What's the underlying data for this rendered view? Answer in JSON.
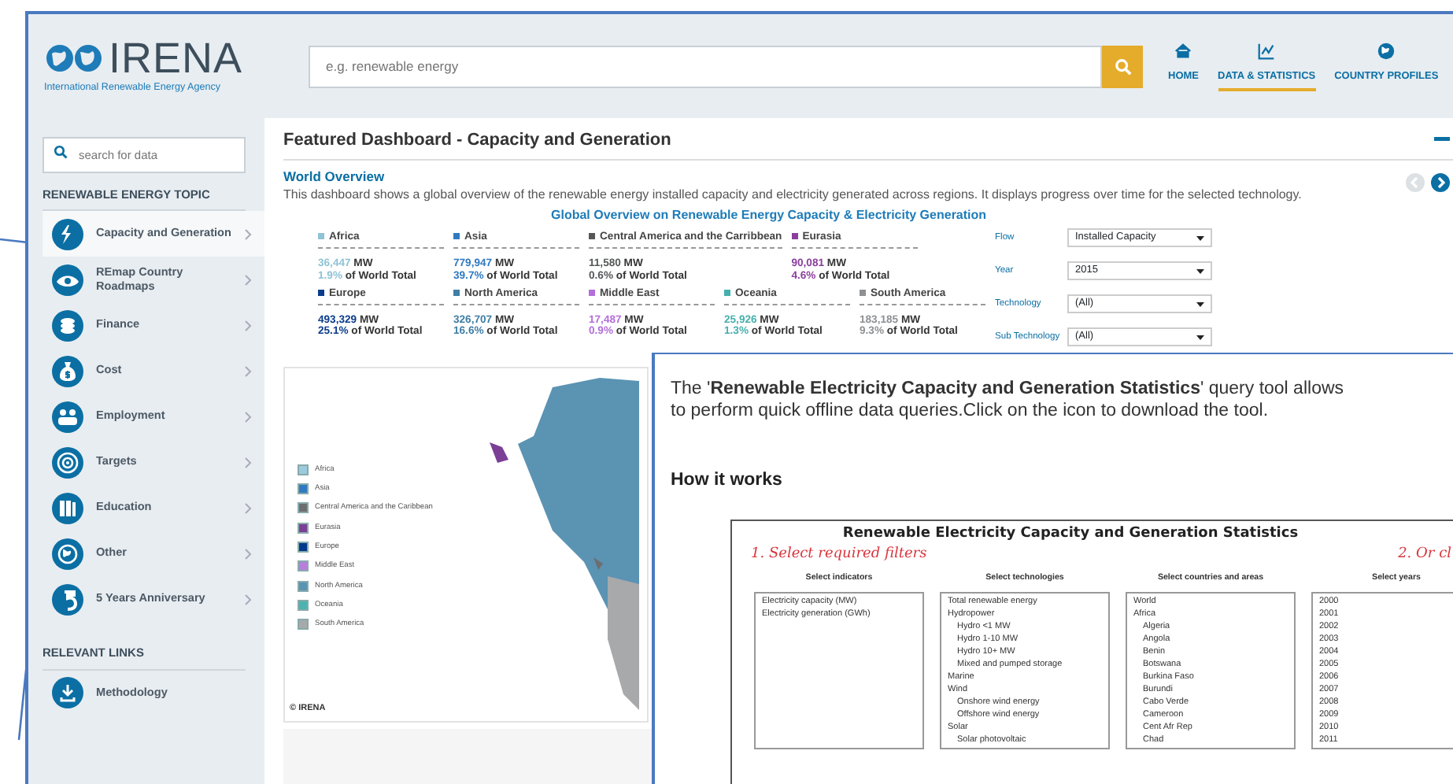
{
  "header": {
    "logo": {
      "name": "IRENA",
      "tagline": "International Renewable Energy Agency"
    },
    "search": {
      "placeholder": "e.g. renewable energy"
    },
    "nav": [
      {
        "label": "HOME",
        "kind": "home",
        "selected": false
      },
      {
        "label": "DATA & STATISTICS",
        "kind": "chart",
        "selected": true
      },
      {
        "label": "COUNTRY PROFILES",
        "kind": "globe",
        "selected": false
      }
    ]
  },
  "sidebar": {
    "search": {
      "placeholder": "search for data"
    },
    "topics_title": "RENEWABLE ENERGY TOPIC",
    "topics": [
      {
        "label": "Capacity and Generation",
        "kind": "lightning",
        "selected": true
      },
      {
        "label": "REmap Country Roadmaps",
        "kind": "eye",
        "selected": false
      },
      {
        "label": "Finance",
        "kind": "coins",
        "selected": false
      },
      {
        "label": "Cost",
        "kind": "moneybag",
        "selected": false
      },
      {
        "label": "Employment",
        "kind": "people",
        "selected": false
      },
      {
        "label": "Targets",
        "kind": "target",
        "selected": false
      },
      {
        "label": "Education",
        "kind": "books",
        "selected": false
      },
      {
        "label": "Other",
        "kind": "globe",
        "selected": false
      },
      {
        "label": "5 Years Anniversary",
        "kind": "five",
        "selected": false
      }
    ],
    "links_title": "RELEVANT LINKS",
    "links": [
      {
        "label": "Methodology"
      }
    ]
  },
  "dashboard": {
    "title": "Featured Dashboard - Capacity and Generation",
    "subtitle": "World Overview",
    "description": "This dashboard shows a global overview of the renewable energy installed capacity and electricity generated across regions. It displays progress over time for the selected technology.",
    "chart_title": "Global Overview on Renewable Energy Capacity & Electricity Generation",
    "region_rows": [
      [
        {
          "name": "Africa",
          "color": "#8fc3d6",
          "value": "36,447",
          "unit": "MW",
          "share": "1.9%",
          "share_label": "of World Total"
        },
        {
          "name": "Asia",
          "color": "#2f7ac0",
          "value": "779,947",
          "unit": "MW",
          "share": "39.7%",
          "share_label": "of World Total"
        },
        {
          "name": "Central America and the Carribbean",
          "color": "#555759",
          "value": "11,580",
          "unit": "MW",
          "share": "0.6%",
          "share_label": "of World Total"
        },
        {
          "name": "Eurasia",
          "color": "#8a3f9c",
          "value": "90,081",
          "unit": "MW",
          "share": "4.6%",
          "share_label": "of World Total"
        }
      ],
      [
        {
          "name": "Europe",
          "color": "#0b3c8c",
          "value": "493,329",
          "unit": "MW",
          "share": "25.1%",
          "share_label": "of World Total"
        },
        {
          "name": "North America",
          "color": "#3f7ea6",
          "value": "326,707",
          "unit": "MW",
          "share": "16.6%",
          "share_label": "of World Total"
        },
        {
          "name": "Middle East",
          "color": "#b46fd9",
          "value": "17,487",
          "unit": "MW",
          "share": "0.9%",
          "share_label": "of World Total"
        },
        {
          "name": "Oceania",
          "color": "#45b0ad",
          "value": "25,926",
          "unit": "MW",
          "share": "1.3%",
          "share_label": "of World Total"
        },
        {
          "name": "South America",
          "color": "#8e9194",
          "value": "183,185",
          "unit": "MW",
          "share": "9.3%",
          "share_label": "of World Total"
        }
      ]
    ],
    "filters": [
      {
        "label": "Flow",
        "value": "Installed Capacity"
      },
      {
        "label": "Year",
        "value": "2015"
      },
      {
        "label": "Technology",
        "value": "(All)"
      },
      {
        "label": "Sub Technology",
        "value": "(All)"
      }
    ],
    "legend": [
      {
        "name": "Africa",
        "color": "#9ccbdf"
      },
      {
        "name": "Asia",
        "color": "#2f7ac0"
      },
      {
        "name": "Central America and the Caribbean",
        "color": "#6d6e70"
      },
      {
        "name": "Eurasia",
        "color": "#7b3f96"
      },
      {
        "name": "Europe",
        "color": "#003a8c"
      },
      {
        "name": "Middle East",
        "color": "#b77fdc"
      },
      {
        "name": "North America",
        "color": "#5b93b3"
      },
      {
        "name": "Oceania",
        "color": "#4db3b0"
      },
      {
        "name": "South America",
        "color": "#a7a9ab"
      }
    ],
    "copyright": "© IRENA"
  },
  "overlay": {
    "intro": [
      "The '**Renewable Electricity Capacity and Generation Statistics**' query tool allows",
      "to perform quick offline data queries.Click on the icon to download the tool."
    ],
    "heading": "How it works",
    "tool": {
      "title": "Renewable Electricity Capacity and Generation Statistics",
      "step_1": "1. Select required filters",
      "step_2": "2. Or cl",
      "columns": [
        {
          "heading": "Select indicators",
          "items": [
            {
              "label": "Electricity capacity (MW)"
            },
            {
              "label": "Electricity generation (GWh)"
            }
          ]
        },
        {
          "heading": "Select technologies",
          "items": [
            {
              "label": "Total renewable energy"
            },
            {
              "label": "Hydropower",
              "children": [
                {
                  "label": "Hydro <1 MW"
                },
                {
                  "label": "Hydro 1-10 MW"
                },
                {
                  "label": "Hydro 10+ MW"
                },
                {
                  "label": "Mixed and pumped storage"
                }
              ]
            },
            {
              "label": "Marine"
            },
            {
              "label": "Wind",
              "children": [
                {
                  "label": "Onshore wind energy"
                },
                {
                  "label": "Offshore wind energy"
                }
              ]
            },
            {
              "label": "Solar",
              "children": [
                {
                  "label": "Solar photovoltaic"
                }
              ]
            }
          ]
        },
        {
          "heading": "Select countries and areas",
          "items": [
            {
              "label": "World"
            },
            {
              "label": "Africa",
              "children": [
                {
                  "label": "Algeria"
                },
                {
                  "label": "Angola"
                },
                {
                  "label": "Benin"
                },
                {
                  "label": "Botswana"
                },
                {
                  "label": "Burkina Faso"
                },
                {
                  "label": "Burundi"
                },
                {
                  "label": "Cabo Verde"
                },
                {
                  "label": "Cameroon"
                },
                {
                  "label": "Cent Afr Rep"
                },
                {
                  "label": "Chad"
                }
              ]
            }
          ]
        },
        {
          "heading": "Select years",
          "items": [
            {
              "label": "2000"
            },
            {
              "label": "2001"
            },
            {
              "label": "2002"
            },
            {
              "label": "2003"
            },
            {
              "label": "2004"
            },
            {
              "label": "2005"
            },
            {
              "label": "2006"
            },
            {
              "label": "2007"
            },
            {
              "label": "2008"
            },
            {
              "label": "2009"
            },
            {
              "label": "2010"
            },
            {
              "label": "2011"
            }
          ]
        }
      ]
    }
  }
}
